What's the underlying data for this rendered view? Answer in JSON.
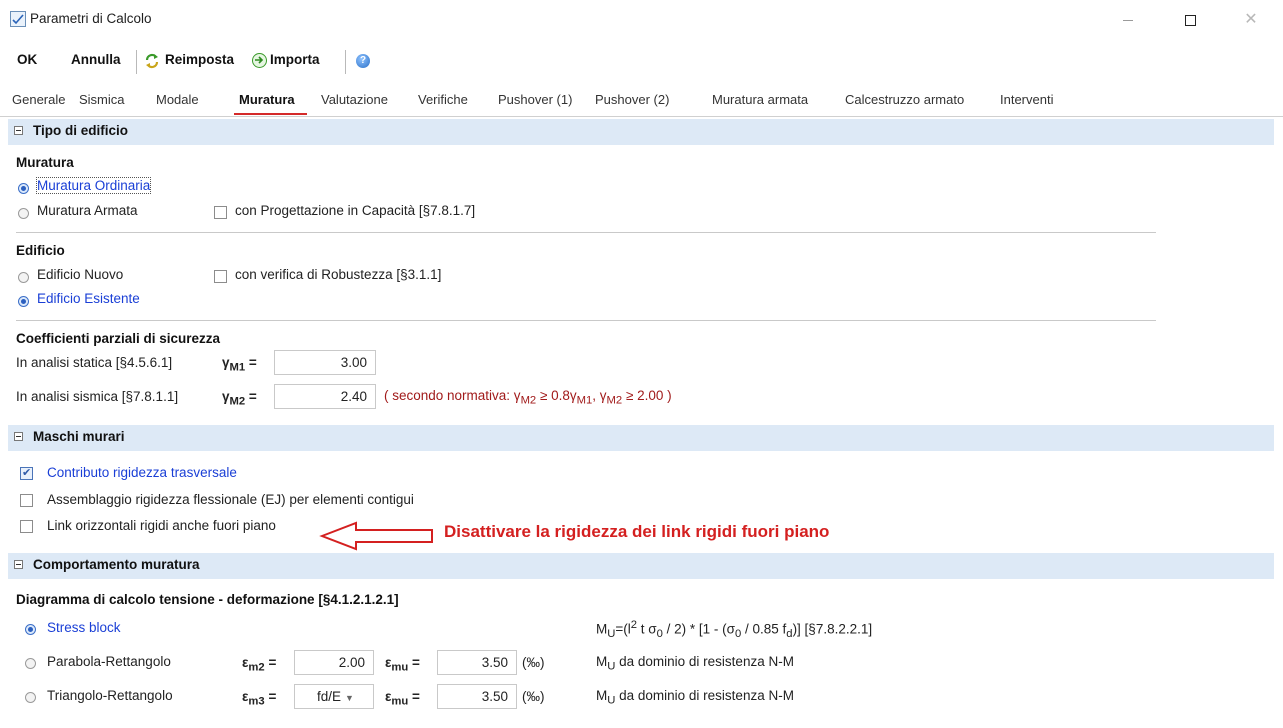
{
  "window": {
    "title": "Parametri di Calcolo",
    "close_glyph": "✕"
  },
  "toolbar": {
    "ok": "OK",
    "cancel": "Annulla",
    "reset": "Reimposta",
    "import": "Importa",
    "help_icon": "help-icon"
  },
  "tabs": [
    {
      "label": "Generale"
    },
    {
      "label": "Sismica"
    },
    {
      "label": "Modale"
    },
    {
      "label": "Muratura"
    },
    {
      "label": "Valutazione"
    },
    {
      "label": "Verifiche"
    },
    {
      "label": "Pushover (1)"
    },
    {
      "label": "Pushover (2)"
    },
    {
      "label": "Muratura armata"
    },
    {
      "label": "Calcestruzzo armato"
    },
    {
      "label": "Interventi"
    }
  ],
  "active_tab": "Muratura",
  "sections": {
    "tipo_edificio": {
      "title": "Tipo di edificio",
      "muratura": {
        "title": "Muratura",
        "ordinaria": "Muratura Ordinaria",
        "armata": "Muratura Armata",
        "capacita": "con Progettazione in Capacità [§7.8.1.7]",
        "selected": "Muratura Ordinaria"
      },
      "edificio": {
        "title": "Edificio",
        "nuovo": "Edificio Nuovo",
        "esistente": "Edificio Esistente",
        "robustezza": "con verifica di Robustezza [§3.1.1]",
        "selected": "Edificio Esistente"
      },
      "coefficienti": {
        "title": "Coefficienti parziali di sicurezza",
        "statica": {
          "label": "In analisi statica [§4.5.6.1]",
          "symbol": "γ",
          "sub": "M1",
          "eq": " =",
          "value": "3.00"
        },
        "sismica": {
          "label": "In analisi sismica [§7.8.1.1]",
          "symbol": "γ",
          "sub": "M2",
          "eq": " =",
          "value": "2.40"
        },
        "note": {
          "p1": "( secondo normativa: γ",
          "s1": "M2",
          "p2": " ≥ 0.8γ",
          "s2": "M1",
          "p3": ", γ",
          "s3": "M2",
          "p4": " ≥ 2.00 )"
        }
      }
    },
    "maschi": {
      "title": "Maschi murari",
      "contributo": {
        "label": "Contributo rigidezza trasversale",
        "checked": true
      },
      "assemblaggio": {
        "label": "Assemblaggio rigidezza flessionale (EJ) per elementi contigui",
        "checked": false
      },
      "link": {
        "label": "Link orizzontali rigidi anche fuori piano",
        "checked": false
      }
    },
    "comportamento": {
      "title": "Comportamento muratura",
      "diagramma_title": "Diagramma di calcolo tensione - deformazione [§4.1.2.1.2.1]",
      "stress_block": {
        "label": "Stress block",
        "formula": {
          "a": "M",
          "a_sub": "U",
          "b": "=(l",
          "b_sup": "2",
          "c": " t σ",
          "c_sub": "0",
          "d": " / 2) * [1 - (σ",
          "d_sub": "0",
          "e": " / 0.85 f",
          "e_sub": "d",
          "f": ")]    [§7.8.2.2.1]"
        }
      },
      "parabola": {
        "label": "Parabola-Rettangolo",
        "eps1": "ε",
        "eps1_sub": "m2",
        "eq": " =",
        "eps1_value": "2.00",
        "eps2": "ε",
        "eps2_sub": "mu",
        "eps2_value": "3.50",
        "unit": "(‰)",
        "mu_text": "M",
        "mu_sub": "U",
        "mu_rest": " da dominio di resistenza N-M"
      },
      "triangolo": {
        "label": "Triangolo-Rettangolo",
        "eps1": "ε",
        "eps1_sub": "m3",
        "eq": " =",
        "eps1_value": "fd/E",
        "eps2": "ε",
        "eps2_sub": "mu",
        "eps2_value": "3.50",
        "unit": "(‰)",
        "mu_text": "M",
        "mu_sub": "U",
        "mu_rest": " da dominio di resistenza N-M"
      },
      "selected": "Stress block"
    }
  },
  "annotation": {
    "text": "Disattivare la rigidezza dei link rigidi fuori piano"
  },
  "colors": {
    "section_bg": "#dde9f6",
    "accent_red": "#d42020",
    "link_blue": "#1a3fd6",
    "note_red": "#a11a1a"
  }
}
